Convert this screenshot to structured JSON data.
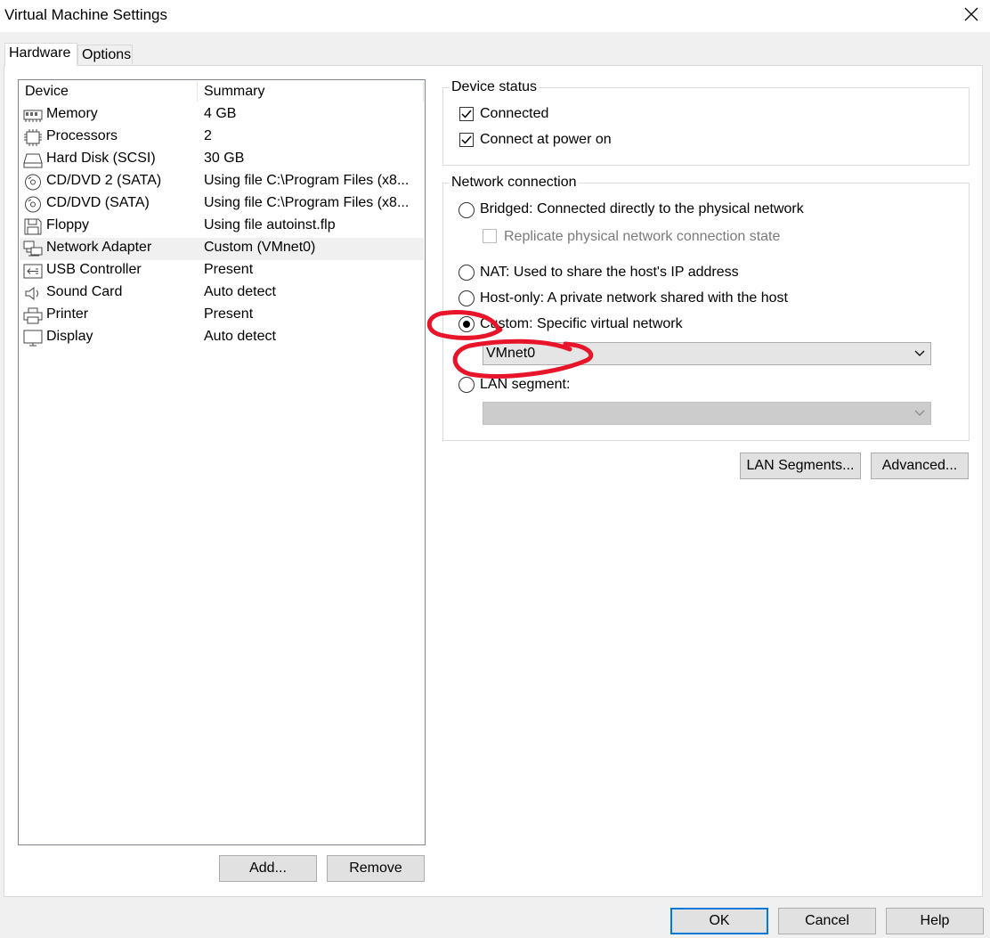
{
  "window": {
    "title": "Virtual Machine Settings"
  },
  "tabs": [
    {
      "label": "Hardware",
      "active": true
    },
    {
      "label": "Options",
      "active": false
    }
  ],
  "device_list": {
    "columns": [
      "Device",
      "Summary"
    ],
    "rows": [
      {
        "icon": "memory-icon",
        "device": "Memory",
        "summary": "4 GB"
      },
      {
        "icon": "processor-icon",
        "device": "Processors",
        "summary": "2"
      },
      {
        "icon": "hard-disk-icon",
        "device": "Hard Disk (SCSI)",
        "summary": "30 GB"
      },
      {
        "icon": "cd-dvd-icon",
        "device": "CD/DVD 2 (SATA)",
        "summary": "Using file C:\\Program Files (x8..."
      },
      {
        "icon": "cd-dvd-icon",
        "device": "CD/DVD (SATA)",
        "summary": "Using file C:\\Program Files (x8..."
      },
      {
        "icon": "floppy-icon",
        "device": "Floppy",
        "summary": "Using file autoinst.flp"
      },
      {
        "icon": "network-adapter-icon",
        "device": "Network Adapter",
        "summary": "Custom (VMnet0)",
        "selected": true
      },
      {
        "icon": "usb-icon",
        "device": "USB Controller",
        "summary": "Present"
      },
      {
        "icon": "sound-card-icon",
        "device": "Sound Card",
        "summary": "Auto detect"
      },
      {
        "icon": "printer-icon",
        "device": "Printer",
        "summary": "Present"
      },
      {
        "icon": "display-icon",
        "device": "Display",
        "summary": "Auto detect"
      }
    ]
  },
  "list_buttons": {
    "add": "Add...",
    "remove": "Remove"
  },
  "device_status": {
    "legend": "Device status",
    "connected": {
      "label": "Connected",
      "checked": true
    },
    "connect_at_power_on": {
      "label": "Connect at power on",
      "checked": true
    }
  },
  "network_connection": {
    "legend": "Network connection",
    "bridged": {
      "label": "Bridged: Connected directly to the physical network",
      "selected": false
    },
    "replicate": {
      "label": "Replicate physical network connection state",
      "checked": false,
      "enabled": false
    },
    "nat": {
      "label": "NAT: Used to share the host's IP address",
      "selected": false
    },
    "host_only": {
      "label": "Host-only: A private network shared with the host",
      "selected": false
    },
    "custom": {
      "label": "Custom: Specific virtual network",
      "selected": true,
      "value": "VMnet0"
    },
    "lan_segment": {
      "label": "LAN segment:",
      "selected": false,
      "value": ""
    }
  },
  "adapter_buttons": {
    "lan_segments": "LAN Segments...",
    "advanced": "Advanced..."
  },
  "dialog_buttons": {
    "ok": "OK",
    "cancel": "Cancel",
    "help": "Help"
  },
  "colors": {
    "annotation": "#e8152a",
    "accent": "#0078d7",
    "selection": "#f0f0f0"
  }
}
